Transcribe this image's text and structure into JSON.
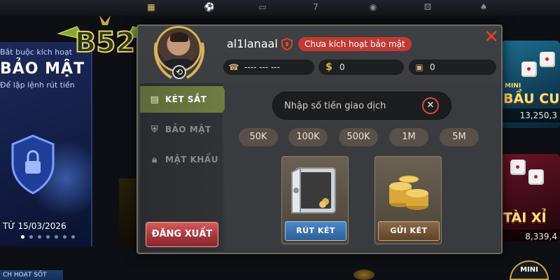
{
  "logo": {
    "text": "B52"
  },
  "lobby": {
    "banner": {
      "line1": "Bắt buộc kích hoạt",
      "line2": "BẢO MẬT",
      "line3": "Để lập lệnh rút tiền",
      "date": "TỪ 15/03/2026"
    },
    "bottom_left_label": "CH HOẠT SỐT",
    "tiles": [
      {
        "name": "BẦU CU",
        "small": "MINI",
        "amount": "13,250,3"
      },
      {
        "name": "TÀI XỈ",
        "amount": "8,339,4"
      }
    ],
    "mini_badge": "MINI"
  },
  "modal": {
    "username": "al1lanaal",
    "security_badge": "Chưa kích hoạt bảo mật",
    "phone": "---- --- ---",
    "coin_symbol": "$",
    "balance": "0",
    "safe_balance": "0",
    "sidebar": {
      "items": [
        {
          "label": "KÉT SẮT",
          "icon": "chat-safe-icon",
          "active": true
        },
        {
          "label": "BẢO MẬT",
          "icon": "shield-icon",
          "active": false
        },
        {
          "label": "MẬT KHẨU",
          "icon": "lock-icon",
          "active": false
        }
      ],
      "logout_label": "ĐĂNG XUẤT"
    },
    "amount_placeholder": "Nhập số tiền giao dịch",
    "chips": [
      "50K",
      "100K",
      "500K",
      "1M",
      "5M"
    ],
    "withdraw_label": "RÚT KÉT",
    "deposit_label": "GỬI KÉT"
  },
  "colors": {
    "accent_green": "#6f7d43",
    "danger_red": "#c23a33",
    "close_red": "#e0442a",
    "gold": "#d9b258"
  }
}
